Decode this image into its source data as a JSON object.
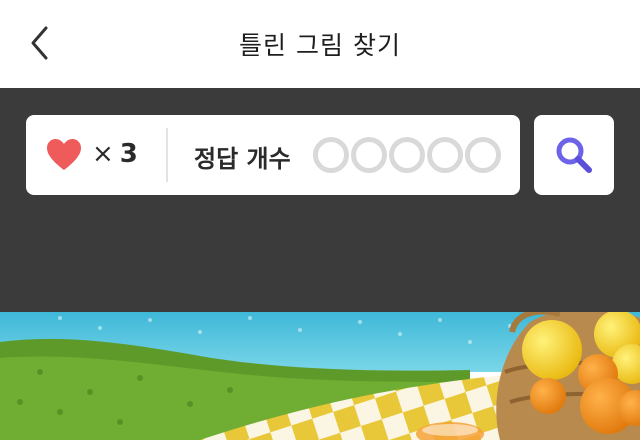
{
  "header": {
    "title": "틀린 그림 찾기",
    "back_icon": "chevron-left-icon"
  },
  "status": {
    "lives_icon": "heart-icon",
    "lives_multiplier": "×",
    "lives_count": "3",
    "answer_label": "정답 개수",
    "answers_found": 0,
    "answers_total": 5
  },
  "search": {
    "icon": "magnifier-icon"
  },
  "colors": {
    "panel": "#3b3b3b",
    "heart": "#ef5b5b",
    "search_accent": "#6c63e8",
    "slot_empty": "#d9d9d9"
  }
}
